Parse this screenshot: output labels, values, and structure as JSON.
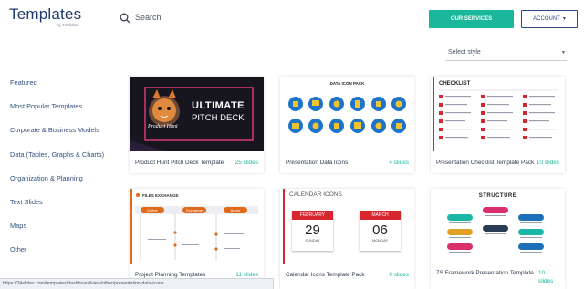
{
  "header": {
    "logo_title": "Templates",
    "logo_sub": "by 24Slides",
    "search_label": "Search",
    "services_button": "OUR SERVICES",
    "account_button": "ACCOUNT"
  },
  "filter": {
    "select_style_label": "Select style"
  },
  "sidebar": {
    "items": [
      {
        "label": "Featured"
      },
      {
        "label": "Most Popular Templates"
      },
      {
        "label": "Corporate & Business Models"
      },
      {
        "label": "Data (Tables, Graphs & Charts)"
      },
      {
        "label": "Organization & Planning"
      },
      {
        "label": "Text Slides"
      },
      {
        "label": "Maps"
      },
      {
        "label": "Other"
      }
    ]
  },
  "cards": [
    {
      "title": "Product Hunt Pitch Deck Template",
      "count": "25 slides",
      "thumb": {
        "big": "ULTIMATE",
        "small": "PITCH DECK",
        "script": "Product Hunt"
      }
    },
    {
      "title": "Presentation Data Icons",
      "count": "4 slides",
      "thumb": {
        "heading": "DATA ICON PACK"
      }
    },
    {
      "title": "Presentation Checklist Template Pack",
      "count": "10 slides",
      "thumb": {
        "heading": "CHECKLIST"
      }
    },
    {
      "title": "Project Planning Templates",
      "count": "11 slides",
      "thumb": {
        "heading": "FILES EXCHANGE",
        "pills": [
          "Define",
          "Exchange",
          "Agree"
        ]
      }
    },
    {
      "title": "Calendar Icons Template Pack",
      "count": "9 slides",
      "thumb": {
        "heading": "CALENDAR ICONS",
        "cal1": {
          "month": "FEBRUARY",
          "day": "29",
          "weekday": "SUNDAY"
        },
        "cal2": {
          "month": "MARCH",
          "day": "06",
          "weekday": "MONDAY"
        }
      }
    },
    {
      "title": "7S Framework Presentation Template",
      "count": "10 slides",
      "thumb": {
        "heading": "STRUCTURE"
      }
    }
  ],
  "status": {
    "url": "https://24slides.com/templates/dashboard/view/other/presentation-data-icons"
  },
  "colors": {
    "accent": "#1ab79c",
    "brand": "#1e3a6e",
    "red": "#d7262e"
  }
}
